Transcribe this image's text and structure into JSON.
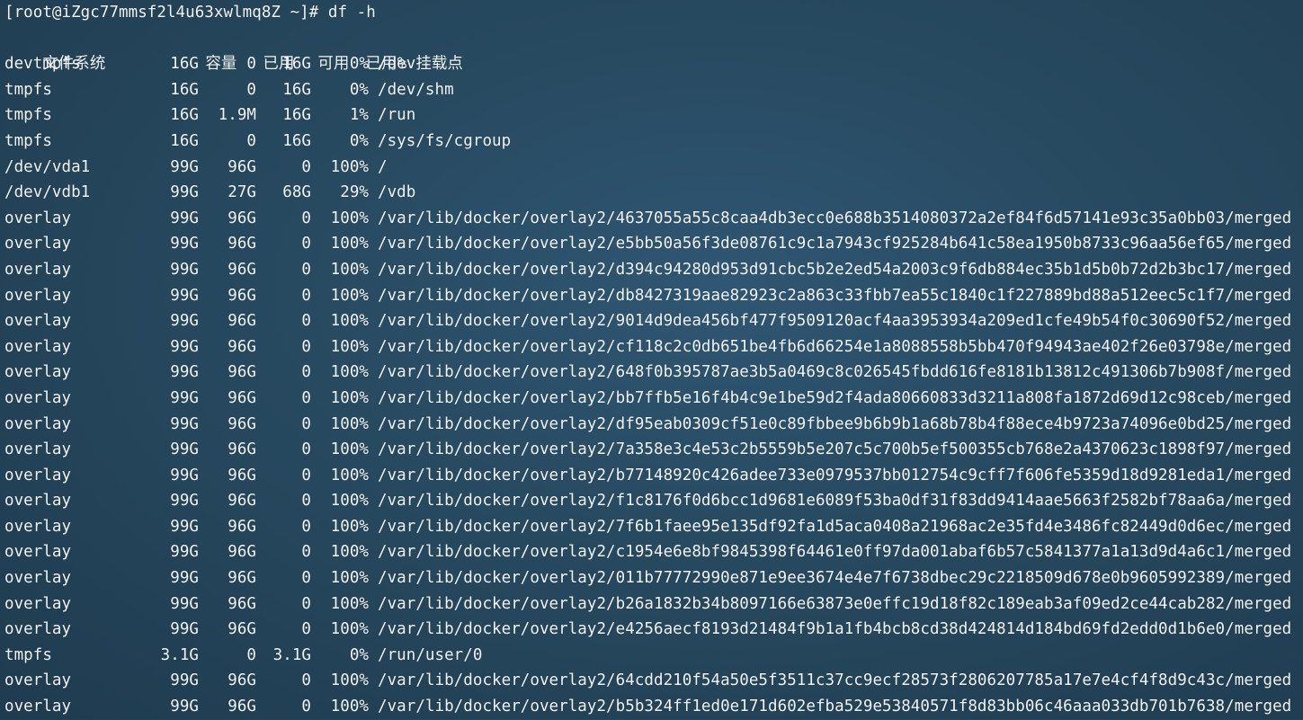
{
  "prompt": "[root@iZgc77mmsf2l4u63xwlmq8Z ~]# df -h",
  "header": {
    "filesystem": "文件系统",
    "size": "容量",
    "used": "已用",
    "avail": "可用",
    "use_pct": "已用%",
    "mounted_on": "挂载点"
  },
  "rows": [
    {
      "filesystem": "devtmpfs",
      "size": "16G",
      "used": "0",
      "avail": "16G",
      "use_pct": "0%",
      "mounted_on": "/dev"
    },
    {
      "filesystem": "tmpfs",
      "size": "16G",
      "used": "0",
      "avail": "16G",
      "use_pct": "0%",
      "mounted_on": "/dev/shm"
    },
    {
      "filesystem": "tmpfs",
      "size": "16G",
      "used": "1.9M",
      "avail": "16G",
      "use_pct": "1%",
      "mounted_on": "/run"
    },
    {
      "filesystem": "tmpfs",
      "size": "16G",
      "used": "0",
      "avail": "16G",
      "use_pct": "0%",
      "mounted_on": "/sys/fs/cgroup"
    },
    {
      "filesystem": "/dev/vda1",
      "size": "99G",
      "used": "96G",
      "avail": "0",
      "use_pct": "100%",
      "mounted_on": "/"
    },
    {
      "filesystem": "/dev/vdb1",
      "size": "99G",
      "used": "27G",
      "avail": "68G",
      "use_pct": "29%",
      "mounted_on": "/vdb"
    },
    {
      "filesystem": "overlay",
      "size": "99G",
      "used": "96G",
      "avail": "0",
      "use_pct": "100%",
      "mounted_on": "/var/lib/docker/overlay2/4637055a55c8caa4db3ecc0e688b3514080372a2ef84f6d57141e93c35a0bb03/merged"
    },
    {
      "filesystem": "overlay",
      "size": "99G",
      "used": "96G",
      "avail": "0",
      "use_pct": "100%",
      "mounted_on": "/var/lib/docker/overlay2/e5bb50a56f3de08761c9c1a7943cf925284b641c58ea1950b8733c96aa56ef65/merged"
    },
    {
      "filesystem": "overlay",
      "size": "99G",
      "used": "96G",
      "avail": "0",
      "use_pct": "100%",
      "mounted_on": "/var/lib/docker/overlay2/d394c94280d953d91cbc5b2e2ed54a2003c9f6db884ec35b1d5b0b72d2b3bc17/merged"
    },
    {
      "filesystem": "overlay",
      "size": "99G",
      "used": "96G",
      "avail": "0",
      "use_pct": "100%",
      "mounted_on": "/var/lib/docker/overlay2/db8427319aae82923c2a863c33fbb7ea55c1840c1f227889bd88a512eec5c1f7/merged"
    },
    {
      "filesystem": "overlay",
      "size": "99G",
      "used": "96G",
      "avail": "0",
      "use_pct": "100%",
      "mounted_on": "/var/lib/docker/overlay2/9014d9dea456bf477f9509120acf4aa3953934a209ed1cfe49b54f0c30690f52/merged"
    },
    {
      "filesystem": "overlay",
      "size": "99G",
      "used": "96G",
      "avail": "0",
      "use_pct": "100%",
      "mounted_on": "/var/lib/docker/overlay2/cf118c2c0db651be4fb6d66254e1a8088558b5bb470f94943ae402f26e03798e/merged"
    },
    {
      "filesystem": "overlay",
      "size": "99G",
      "used": "96G",
      "avail": "0",
      "use_pct": "100%",
      "mounted_on": "/var/lib/docker/overlay2/648f0b395787ae3b5a0469c8c026545fbdd616fe8181b13812c491306b7b908f/merged"
    },
    {
      "filesystem": "overlay",
      "size": "99G",
      "used": "96G",
      "avail": "0",
      "use_pct": "100%",
      "mounted_on": "/var/lib/docker/overlay2/bb7ffb5e16f4b4c9e1be59d2f4ada80660833d3211a808fa1872d69d12c98ceb/merged"
    },
    {
      "filesystem": "overlay",
      "size": "99G",
      "used": "96G",
      "avail": "0",
      "use_pct": "100%",
      "mounted_on": "/var/lib/docker/overlay2/df95eab0309cf51e0c89fbbee9b6b9b1a68b78b4f88ece4b9723a74096e0bd25/merged"
    },
    {
      "filesystem": "overlay",
      "size": "99G",
      "used": "96G",
      "avail": "0",
      "use_pct": "100%",
      "mounted_on": "/var/lib/docker/overlay2/7a358e3c4e53c2b5559b5e207c5c700b5ef500355cb768e2a4370623c1898f97/merged"
    },
    {
      "filesystem": "overlay",
      "size": "99G",
      "used": "96G",
      "avail": "0",
      "use_pct": "100%",
      "mounted_on": "/var/lib/docker/overlay2/b77148920c426adee733e0979537bb012754c9cff7f606fe5359d18d9281eda1/merged"
    },
    {
      "filesystem": "overlay",
      "size": "99G",
      "used": "96G",
      "avail": "0",
      "use_pct": "100%",
      "mounted_on": "/var/lib/docker/overlay2/f1c8176f0d6bcc1d9681e6089f53ba0df31f83dd9414aae5663f2582bf78aa6a/merged"
    },
    {
      "filesystem": "overlay",
      "size": "99G",
      "used": "96G",
      "avail": "0",
      "use_pct": "100%",
      "mounted_on": "/var/lib/docker/overlay2/7f6b1faee95e135df92fa1d5aca0408a21968ac2e35fd4e3486fc82449d0d6ec/merged"
    },
    {
      "filesystem": "overlay",
      "size": "99G",
      "used": "96G",
      "avail": "0",
      "use_pct": "100%",
      "mounted_on": "/var/lib/docker/overlay2/c1954e6e8bf9845398f64461e0ff97da001abaf6b57c5841377a1a13d9d4a6c1/merged"
    },
    {
      "filesystem": "overlay",
      "size": "99G",
      "used": "96G",
      "avail": "0",
      "use_pct": "100%",
      "mounted_on": "/var/lib/docker/overlay2/011b77772990e871e9ee3674e4e7f6738dbec29c2218509d678e0b9605992389/merged"
    },
    {
      "filesystem": "overlay",
      "size": "99G",
      "used": "96G",
      "avail": "0",
      "use_pct": "100%",
      "mounted_on": "/var/lib/docker/overlay2/b26a1832b34b8097166e63873e0effc19d18f82c189eab3af09ed2ce44cab282/merged"
    },
    {
      "filesystem": "overlay",
      "size": "99G",
      "used": "96G",
      "avail": "0",
      "use_pct": "100%",
      "mounted_on": "/var/lib/docker/overlay2/e4256aecf8193d21484f9b1a1fb4bcb8cd38d424814d184bd69fd2edd0d1b6e0/merged"
    },
    {
      "filesystem": "tmpfs",
      "size": "3.1G",
      "used": "0",
      "avail": "3.1G",
      "use_pct": "0%",
      "mounted_on": "/run/user/0"
    },
    {
      "filesystem": "overlay",
      "size": "99G",
      "used": "96G",
      "avail": "0",
      "use_pct": "100%",
      "mounted_on": "/var/lib/docker/overlay2/64cdd210f54a50e5f3511c37cc9ecf28573f2806207785a17e7e4cf4f8d9c43c/merged"
    },
    {
      "filesystem": "overlay",
      "size": "99G",
      "used": "96G",
      "avail": "0",
      "use_pct": "100%",
      "mounted_on": "/var/lib/docker/overlay2/b5b324ff1ed0e171d602efba529e53840571f8d83bb06c46aaa033db701b7638/merged"
    }
  ]
}
